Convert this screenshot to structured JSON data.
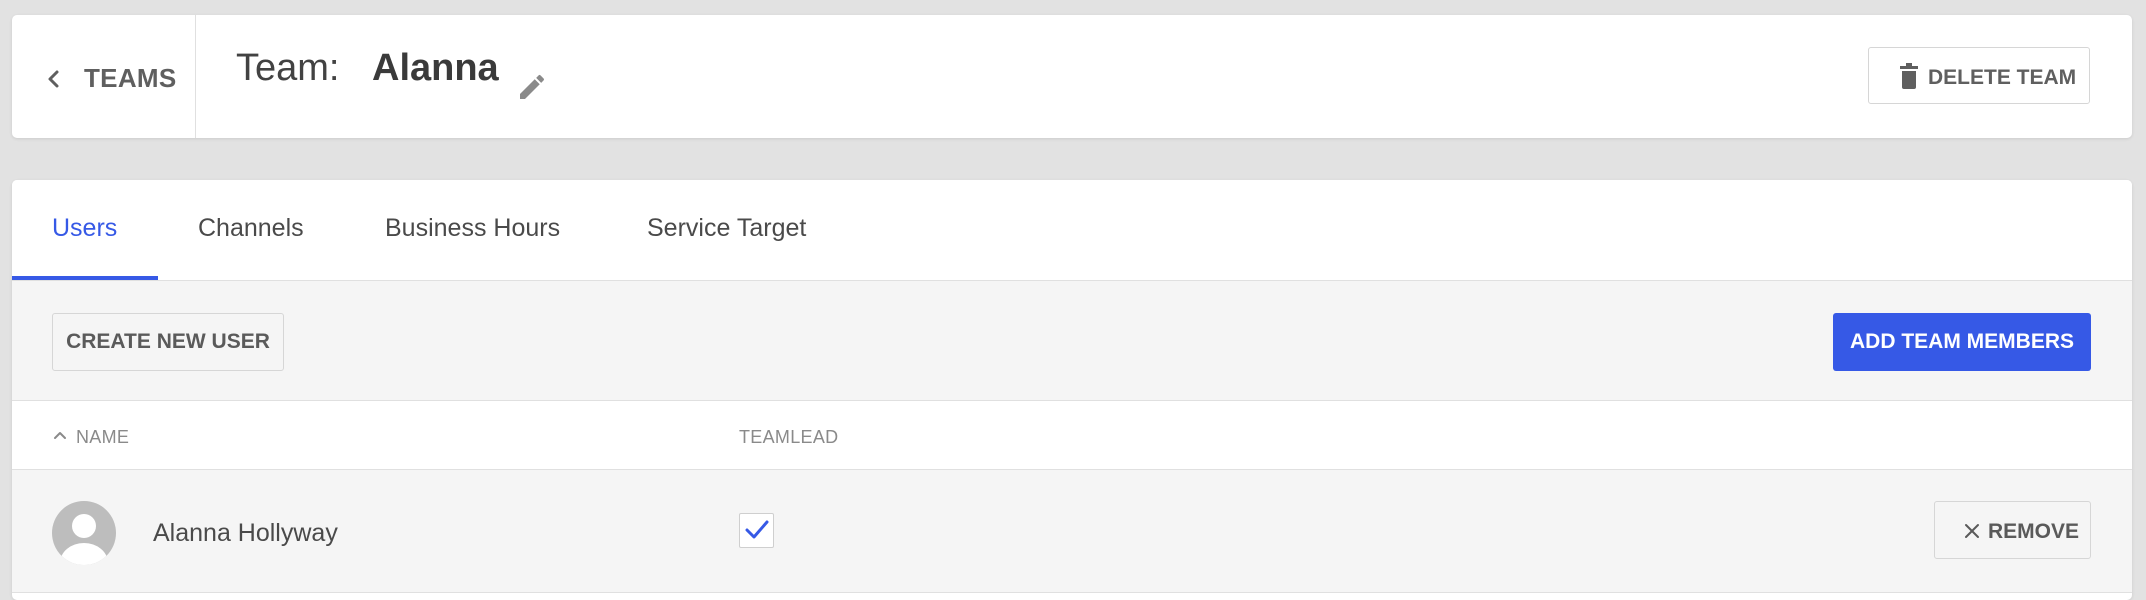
{
  "header": {
    "back_label": "TEAMS",
    "team_prefix": "Team:",
    "team_name": "Alanna",
    "delete_label": "DELETE TEAM"
  },
  "tabs": [
    {
      "label": "Users",
      "active": true
    },
    {
      "label": "Channels",
      "active": false
    },
    {
      "label": "Business Hours",
      "active": false
    },
    {
      "label": "Service Target",
      "active": false
    }
  ],
  "toolbar": {
    "create_label": "CREATE NEW USER",
    "add_label": "ADD TEAM MEMBERS"
  },
  "table": {
    "columns": [
      "NAME",
      "TEAMLEAD"
    ],
    "sort": {
      "column": "NAME",
      "direction": "ascending"
    },
    "rows": [
      {
        "name": "Alanna Hollyway",
        "teamlead": true,
        "action": "REMOVE"
      }
    ]
  },
  "icons": {
    "back": "chevron-left-icon",
    "edit": "pencil-icon",
    "delete": "trash-icon",
    "sort": "chevron-up-icon",
    "avatar": "user-avatar-icon",
    "check": "checkmark-icon",
    "remove": "close-icon"
  },
  "colors": {
    "accent": "#3659e6",
    "background": "#e2e2e2",
    "toolbar_bg": "#f5f5f5"
  }
}
